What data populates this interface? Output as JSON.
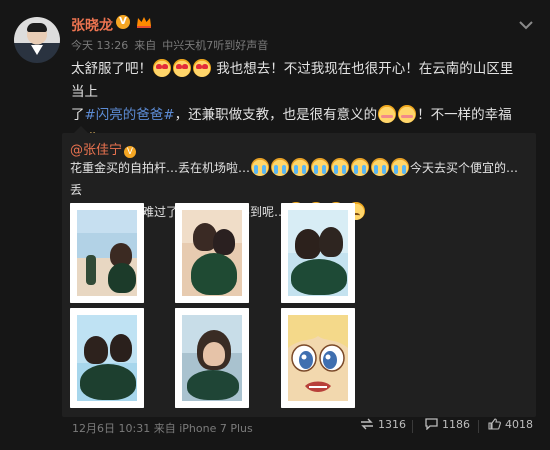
{
  "header": {
    "username": "张晓龙",
    "verified_badge": "V",
    "timestamp": "今天 13:26",
    "via_prefix": "来自",
    "device": "中兴天机7听到好声音"
  },
  "post": {
    "line1": "太舒服了吧！",
    "line1b": "我也想去！不过我现在也很开心！在云南的山区里当上",
    "line2a": "了",
    "hashtag": "#闪亮的爸爸#",
    "line2b": "，还兼职做支教，也是很有意义的",
    "line2c": "！不一样的幸福"
  },
  "repost": {
    "at_user": "@张佳宁",
    "verified_badge": "V",
    "text_a": "花重金买的自拍杆…丢在机场啦…",
    "text_b": "今天去买个便宜的…丢",
    "text_c": "了就不会这么难过了…真的好难买到呢…"
  },
  "footer": {
    "date": "12月6日 10:31",
    "via_prefix": "来自",
    "device": "iPhone 7 Plus",
    "repost_count": "1316",
    "comment_count": "1186",
    "like_count": "4018"
  },
  "colors": {
    "username": "#eb7350",
    "hashtag": "#5c8bd4",
    "background": "#161616",
    "repost_bg": "#202020"
  },
  "icons": [
    "chevron-down-icon",
    "member-crown-icon",
    "repost-icon",
    "comment-icon",
    "like-icon"
  ]
}
